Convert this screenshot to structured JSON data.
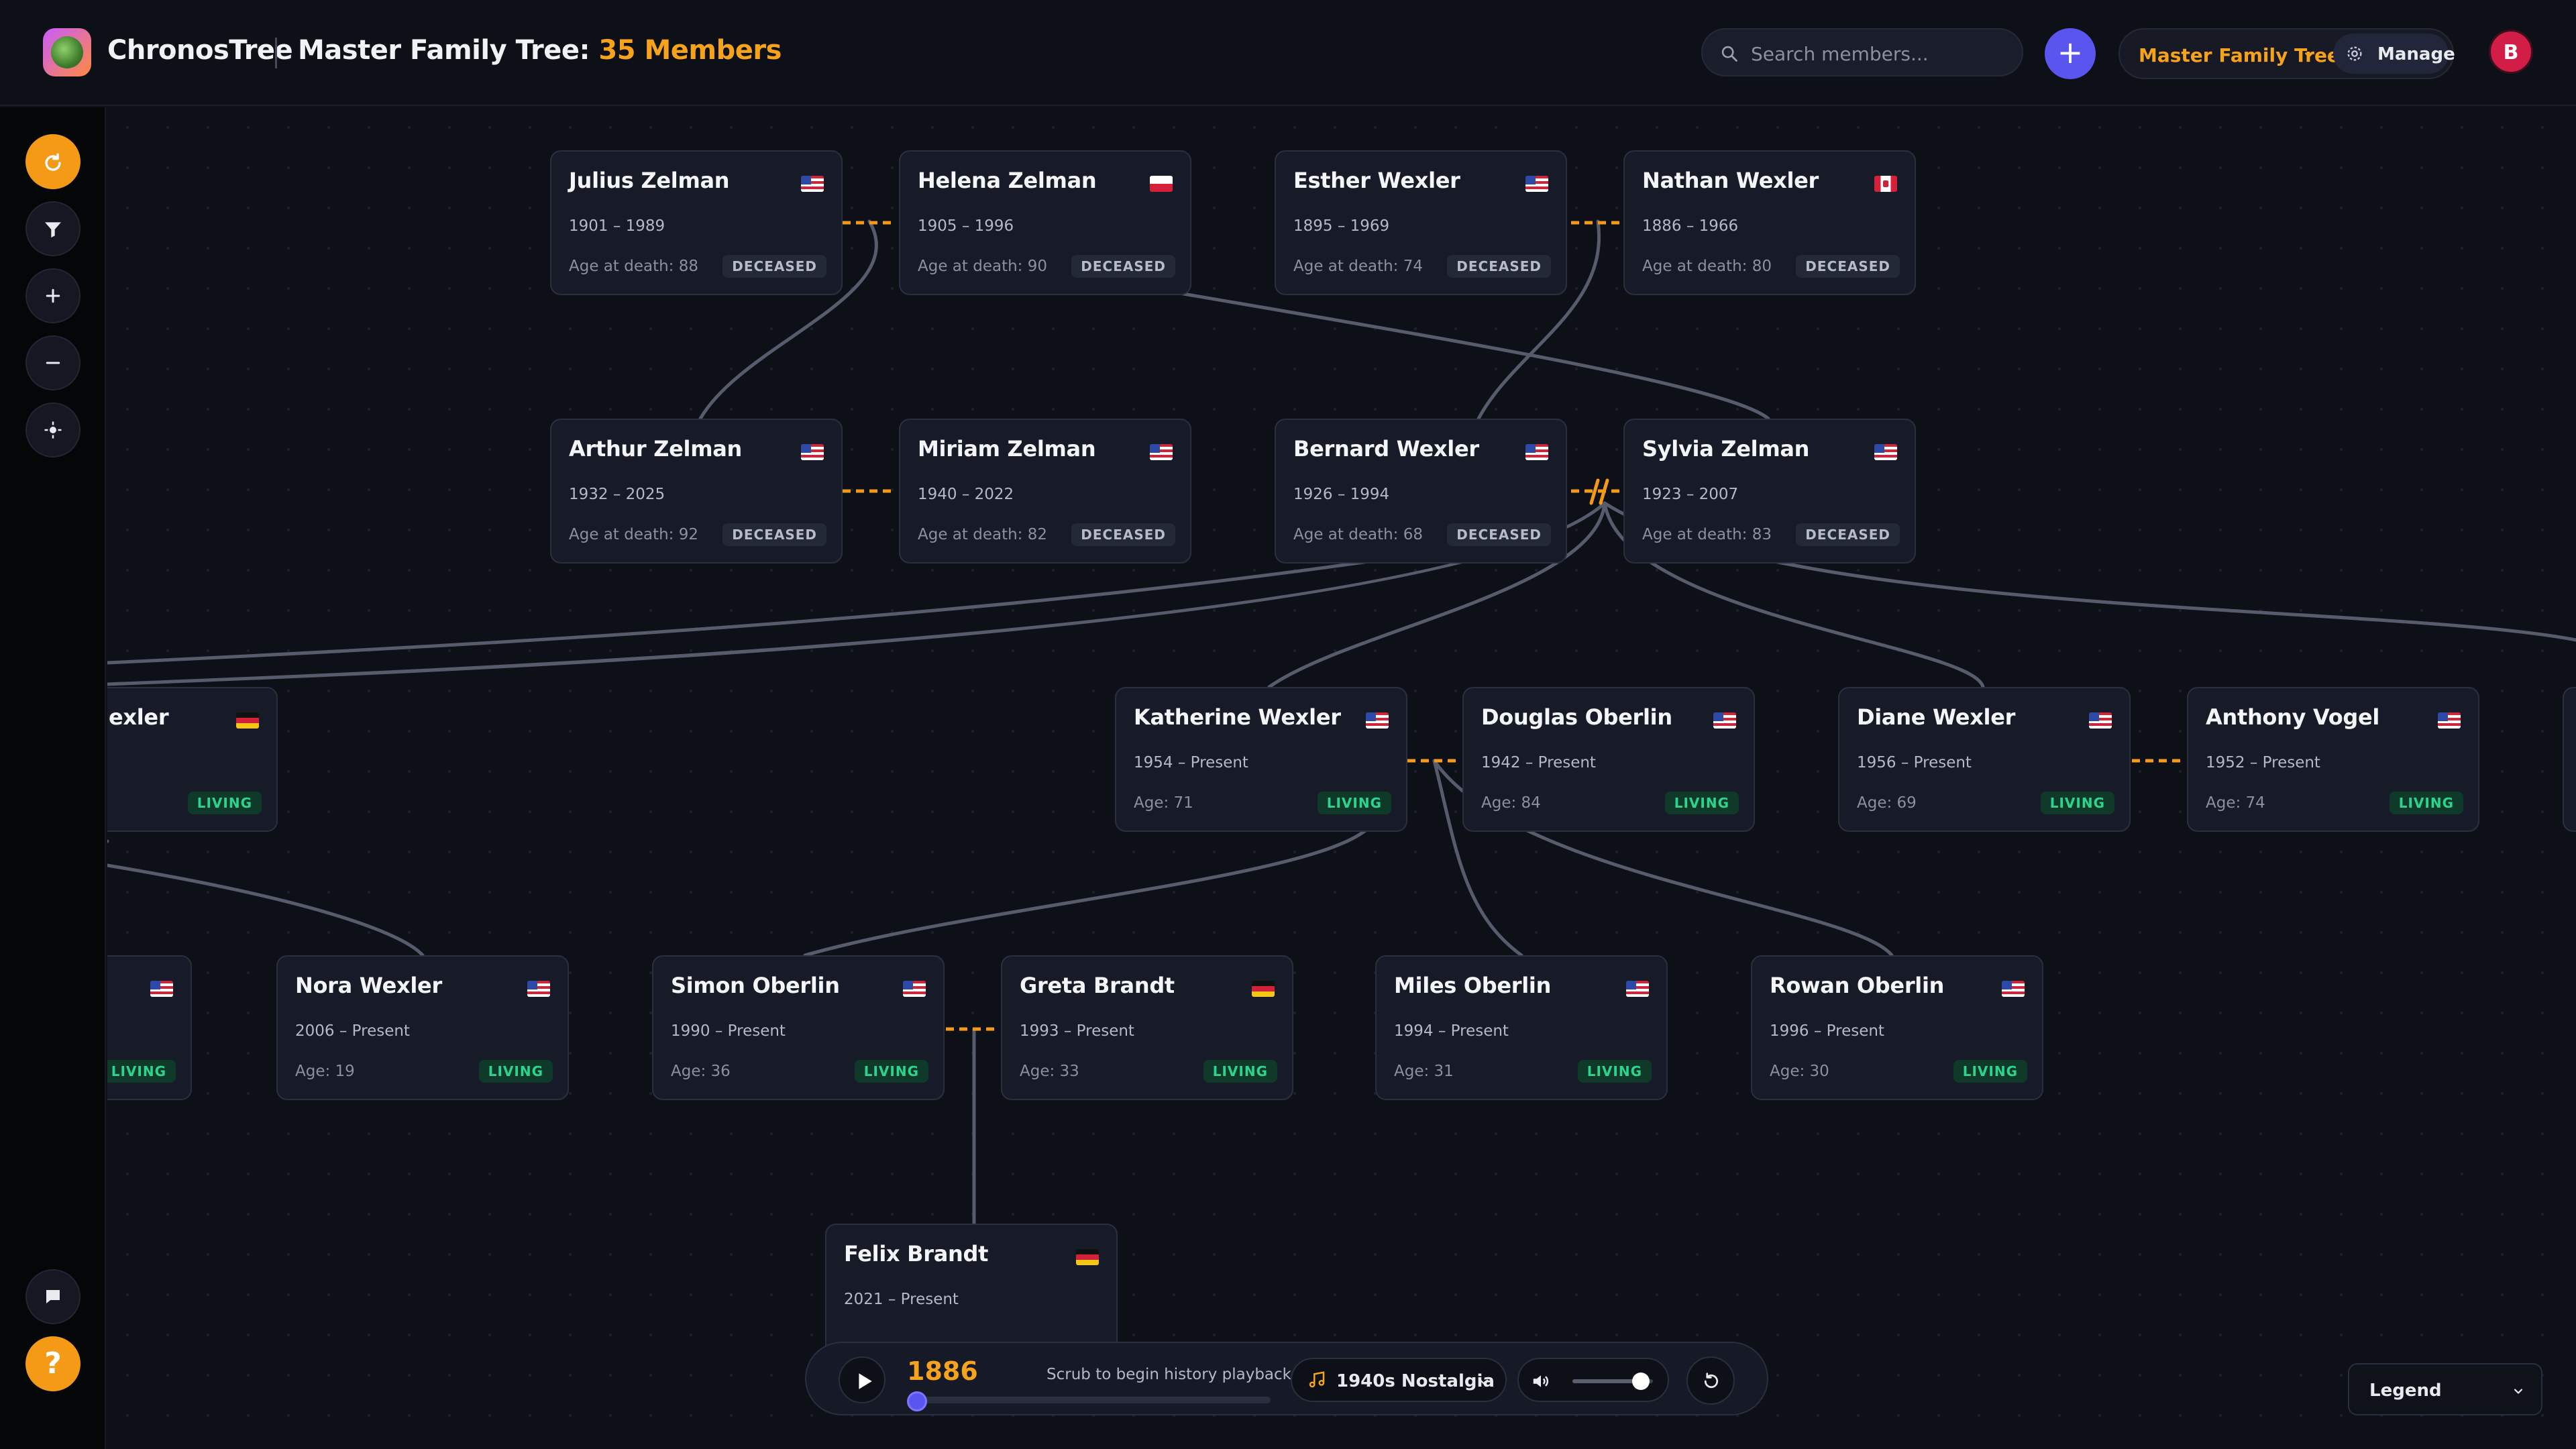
{
  "app": {
    "brand": "ChronosTree",
    "tree_title": "Master Family Tree:",
    "member_count": "35 Members"
  },
  "header": {
    "search_placeholder": "Search members...",
    "add_label": "+",
    "tree_select_label": "Master Family Tree",
    "manage_label": "Manage",
    "avatar_initial": "B"
  },
  "members": [
    {
      "name": "Julius Zelman",
      "flag": "us",
      "years": "1901 – 1989",
      "age": "Age at death: 88",
      "status": "DECEASED"
    },
    {
      "name": "Helena Zelman",
      "flag": "pl",
      "years": "1905 – 1996",
      "age": "Age at death: 90",
      "status": "DECEASED"
    },
    {
      "name": "Esther Wexler",
      "flag": "us",
      "years": "1895 – 1969",
      "age": "Age at death: 74",
      "status": "DECEASED"
    },
    {
      "name": "Nathan Wexler",
      "flag": "ca",
      "years": "1886 – 1966",
      "age": "Age at death: 80",
      "status": "DECEASED"
    },
    {
      "name": "Arthur Zelman",
      "flag": "us",
      "years": "1932 – 2025",
      "age": "Age at death: 92",
      "status": "DECEASED"
    },
    {
      "name": "Miriam Zelman",
      "flag": "us",
      "years": "1940 – 2022",
      "age": "Age at death: 82",
      "status": "DECEASED"
    },
    {
      "name": "Bernard Wexler",
      "flag": "us",
      "years": "1926 – 1994",
      "age": "Age at death: 68",
      "status": "DECEASED"
    },
    {
      "name": "Sylvia Zelman",
      "flag": "us",
      "years": "1923 – 2007",
      "age": "Age at death: 83",
      "status": "DECEASED"
    },
    {
      "name": "exler",
      "flag": "de",
      "years": "",
      "age": "",
      "status": "LIVING"
    },
    {
      "name": "Katherine Wexler",
      "flag": "us",
      "years": "1954 – Present",
      "age": "Age: 71",
      "status": "LIVING"
    },
    {
      "name": "Douglas Oberlin",
      "flag": "us",
      "years": "1942 – Present",
      "age": "Age: 84",
      "status": "LIVING"
    },
    {
      "name": "Diane Wexler",
      "flag": "us",
      "years": "1956 – Present",
      "age": "Age: 69",
      "status": "LIVING"
    },
    {
      "name": "Anthony Vogel",
      "flag": "us",
      "years": "1952 – Present",
      "age": "Age: 74",
      "status": "LIVING"
    },
    {
      "name": "",
      "flag": "us",
      "years": "",
      "age": "",
      "status": "LIVING"
    },
    {
      "name": "Nora Wexler",
      "flag": "us",
      "years": "2006 – Present",
      "age": "Age: 19",
      "status": "LIVING"
    },
    {
      "name": "Simon Oberlin",
      "flag": "us",
      "years": "1990 – Present",
      "age": "Age: 36",
      "status": "LIVING"
    },
    {
      "name": "Greta Brandt",
      "flag": "de",
      "years": "1993 – Present",
      "age": "Age: 33",
      "status": "LIVING"
    },
    {
      "name": "Miles Oberlin",
      "flag": "us",
      "years": "1994 – Present",
      "age": "Age: 31",
      "status": "LIVING"
    },
    {
      "name": "Rowan Oberlin",
      "flag": "us",
      "years": "1996 – Present",
      "age": "Age: 30",
      "status": "LIVING"
    },
    {
      "name": "Felix Brandt",
      "flag": "de",
      "years": "2021 – Present",
      "age": "",
      "status": ""
    }
  ],
  "playback": {
    "year": "1886",
    "hint": "Scrub to begin history playback",
    "progress": 0,
    "music_label": "1940s Nostalgia",
    "volume": 0.85
  },
  "legend": {
    "label": "Legend"
  },
  "colors": {
    "accent": "#f7a21b",
    "primary": "#5b55f0",
    "living": "#2dd48d",
    "danger": "#d21d46"
  }
}
